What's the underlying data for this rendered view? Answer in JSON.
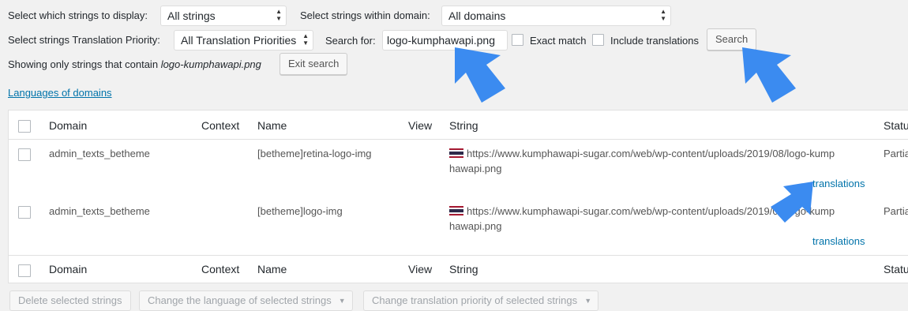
{
  "filters": {
    "display_label": "Select which strings to display:",
    "display_value": "All strings",
    "domain_label": "Select strings within domain:",
    "domain_value": "All domains",
    "priority_label": "Select strings Translation Priority:",
    "priority_value": "All Translation Priorities",
    "search_label": "Search for:",
    "search_value": "logo-kumphawapi.png",
    "exact_match_label": "Exact match",
    "include_translations_label": "Include translations",
    "search_button": "Search",
    "showing_prefix": "Showing only strings that contain",
    "showing_term": "logo-kumphawapi.png",
    "exit_search_button": "Exit search"
  },
  "languages_link": "Languages of domains",
  "table": {
    "headers": {
      "domain": "Domain",
      "context": "Context",
      "name": "Name",
      "view": "View",
      "string": "String",
      "status": "Statu"
    },
    "rows": [
      {
        "domain": "admin_texts_betheme",
        "context": "",
        "name": "[betheme]retina-logo-img",
        "string_line1": "https://www.kumphawapi-sugar.com/web/wp-content/uploads/2019/08/logo-kump",
        "string_line2": "hawapi.png",
        "translations_link": "translations",
        "status": "Partia"
      },
      {
        "domain": "admin_texts_betheme",
        "context": "",
        "name": "[betheme]logo-img",
        "string_line1": "https://www.kumphawapi-sugar.com/web/wp-content/uploads/2019/08/logo-kump",
        "string_line2": "hawapi.png",
        "translations_link": "translations",
        "status": "Partia"
      }
    ]
  },
  "bulk_actions": {
    "delete": "Delete selected strings",
    "change_language": "Change the language of selected strings",
    "change_priority": "Change translation priority of selected strings"
  },
  "icons": {
    "flag": "thailand-flag-icon",
    "pointer": "blue-arrow-annotation-icon"
  },
  "colors": {
    "link": "#0073aa",
    "annotation_arrow": "#3b8bf0",
    "background": "#f1f1f1"
  }
}
